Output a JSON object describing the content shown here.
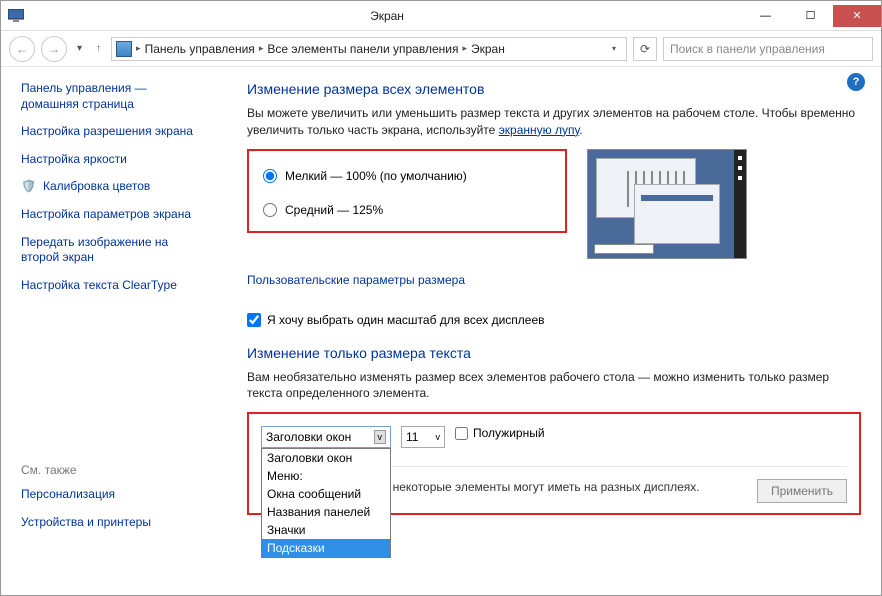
{
  "window": {
    "title": "Экран"
  },
  "nav": {
    "crumbs": [
      "Панель управления",
      "Все элементы панели управления",
      "Экран"
    ],
    "search_placeholder": "Поиск в панели управления"
  },
  "sidebar": {
    "links": [
      "Панель управления — домашняя страница",
      "Настройка разрешения экрана",
      "Настройка яркости",
      "Калибровка цветов",
      "Настройка параметров экрана",
      "Передать изображение на второй экран",
      "Настройка текста ClearType"
    ],
    "seealso_hd": "См. также",
    "seealso": [
      "Персонализация",
      "Устройства и принтеры"
    ]
  },
  "main": {
    "h1": "Изменение размера всех элементов",
    "desc1": "Вы можете увеличить или уменьшить размер текста и других элементов на рабочем столе. Чтобы временно увеличить только часть экрана, используйте ",
    "desc1_link": "экранную лупу",
    "desc1_tail": ".",
    "radio1": "Мелкий — 100% (по умолчанию)",
    "radio2": "Средний — 125%",
    "custom_link": "Пользовательские параметры размера",
    "checkbox": "Я хочу выбрать один масштаб для всех дисплеев",
    "h2": "Изменение только размера текста",
    "desc2": "Вам необязательно изменять размер всех элементов рабочего стола — можно изменить только размер текста определенного элемента.",
    "select_value": "Заголовки окон",
    "options": [
      "Заголовки окон",
      "Меню:",
      "Окна сообщений",
      "Названия панелей",
      "Значки",
      "Подсказки"
    ],
    "size_value": "11",
    "bold_label": "Полужирный",
    "footmsg": "те один масштаб, некоторые элементы могут иметь на разных дисплеях.",
    "apply": "Применить"
  }
}
